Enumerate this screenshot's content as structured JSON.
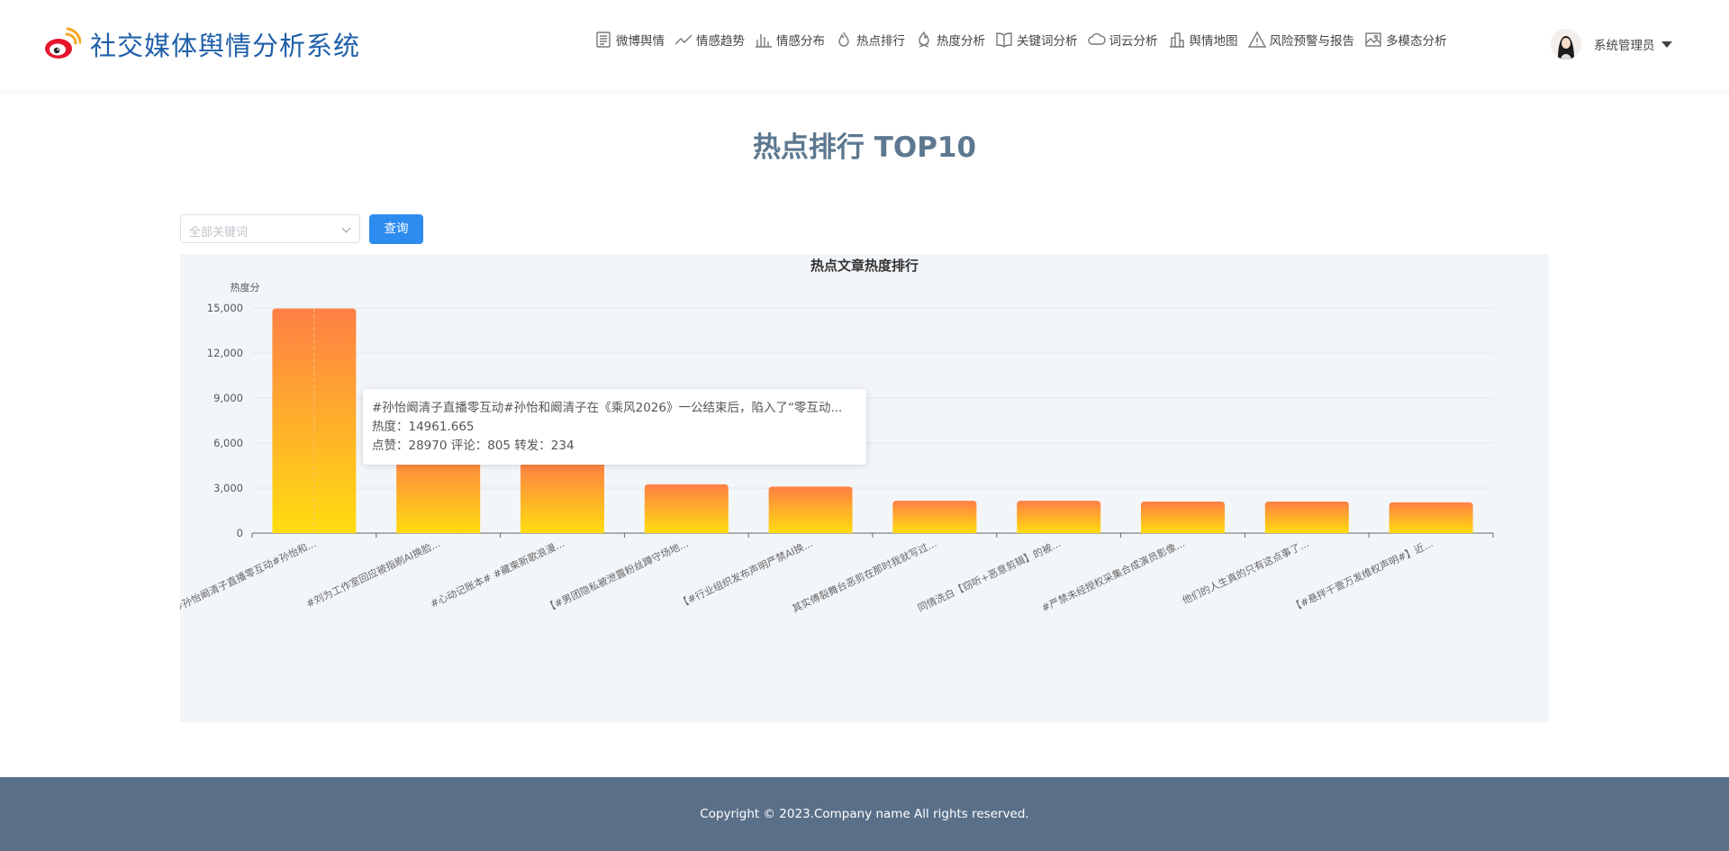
{
  "app": {
    "title": "社交媒体舆情分析系统",
    "logo_icon": "weibo-logo-icon"
  },
  "nav": [
    {
      "label": "微博舆情",
      "icon": "document-icon"
    },
    {
      "label": "情感趋势",
      "icon": "trend-line-icon"
    },
    {
      "label": "情感分布",
      "icon": "bar-chart-icon"
    },
    {
      "label": "热点排行",
      "icon": "flame-icon"
    },
    {
      "label": "热度分析",
      "icon": "fire-icon"
    },
    {
      "label": "关键词分析",
      "icon": "book-icon"
    },
    {
      "label": "词云分析",
      "icon": "cloud-icon"
    },
    {
      "label": "舆情地图",
      "icon": "buildings-icon"
    },
    {
      "label": "风险预警与报告",
      "icon": "warning-icon"
    },
    {
      "label": "多模态分析",
      "icon": "image-icon"
    }
  ],
  "user": {
    "name": "系统管理员"
  },
  "page": {
    "title": "热点排行 TOP10"
  },
  "filter": {
    "placeholder": "全部关键词",
    "query_label": "查询"
  },
  "tooltip": {
    "line1": "#孙怡阚清子直播零互动#孙怡和阚清子在《乘风2026》一公结束后，陷入了“零互动...",
    "line2": "热度：14961.665",
    "line3": "点赞：28970 评论：805 转发：234"
  },
  "footer": {
    "text": "Copyright © 2023.Company name All rights reserved."
  },
  "colors": {
    "accent": "#2d8cf0",
    "bar_top": "#ff7f45",
    "bar_bottom": "#ffdd10",
    "footer": "#5a7089",
    "title": "#5d7890"
  },
  "chart_data": {
    "type": "bar",
    "title": "热点文章热度排行",
    "ylabel": "热度分",
    "ylim": [
      0,
      15000
    ],
    "yticks": [
      "0",
      "3,000",
      "6,000",
      "9,000",
      "12,000",
      "15,000"
    ],
    "categories": [
      "#孙怡阚清子直播零互动#孙怡和...",
      "#刘为工作室回应被指刷AI换脸...",
      "#心动记账本# #藏柬新歌浪漫...",
      "【#男团隐私被泄露粉丝蹲守场地...",
      "【#行业组织发布声明严禁AI换...",
      "其实傅裂舞台恶剪在那时我就写过...",
      "同情洗白【窃听+恶意剪辑】的被...",
      "#严禁未经授权采集合成演员影像...",
      "他们的人生真的只有这点事了...",
      "【#悬拌千壹万发维权声明#】近..."
    ],
    "values": [
      14961.665,
      5300,
      4700,
      3250,
      3100,
      2150,
      2150,
      2100,
      2100,
      2050
    ]
  }
}
